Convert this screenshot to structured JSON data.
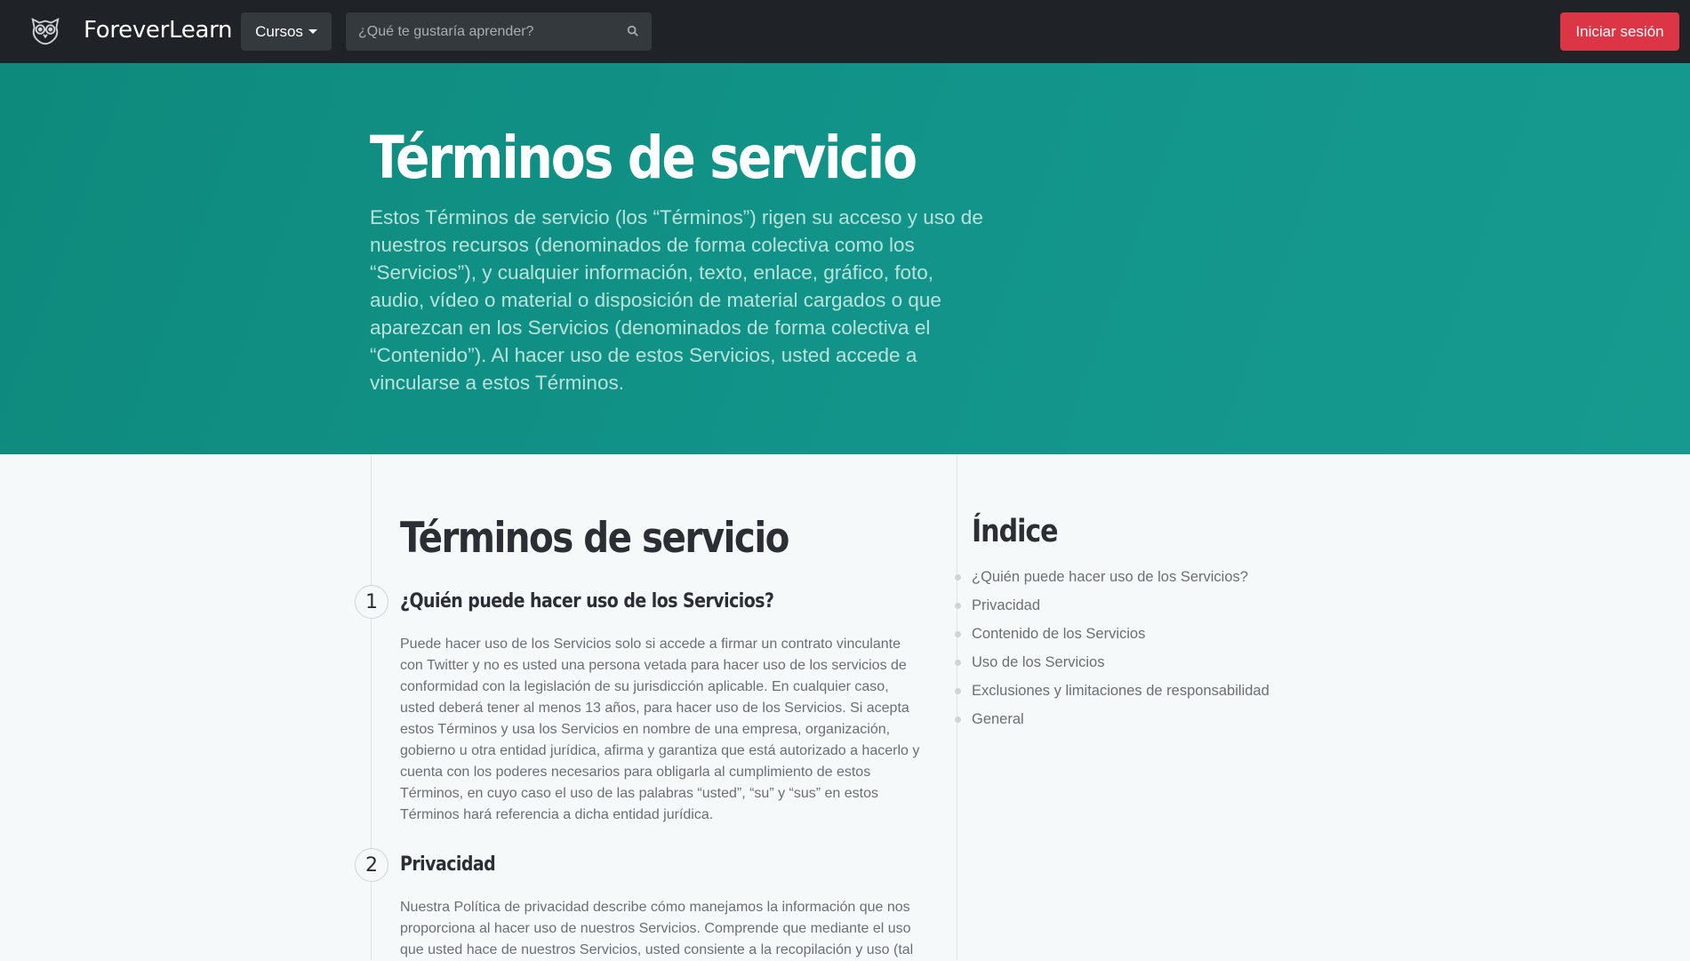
{
  "navbar": {
    "brand_name": "ForeverLearn",
    "logo_icon": "owl-logo-icon",
    "courses_label": "Cursos",
    "search_placeholder": "¿Qué te gustaría aprender?",
    "login_label": "Iniciar sesión"
  },
  "hero": {
    "title": "Términos de servicio",
    "text": "Estos Términos de servicio (los “Términos”) rigen su acceso y uso de nuestros recursos (denominados de forma colectiva como los “Servicios”), y cualquier información, texto, enlace, gráfico, foto, audio, vídeo o material o disposición de material cargados o que aparezcan en los Servicios (denominados de forma colectiva el “Contenido”). Al hacer uso de estos Servicios, usted accede a vincularse a estos Términos."
  },
  "main": {
    "title": "Términos de servicio",
    "sections": [
      {
        "number": "1",
        "title": "¿Quién puede hacer uso de los Servicios?",
        "body": "Puede hacer uso de los Servicios solo si accede a firmar un contrato vinculante con Twitter y no es usted una persona vetada para hacer uso de los servicios de conformidad con la legislación de su jurisdicción aplicable. En cualquier caso, usted deberá tener al menos 13 años, para hacer uso de los Servicios. Si acepta estos Términos y usa los Servicios en nombre de una empresa, organización, gobierno u otra entidad jurídica, afirma y garantiza que está autorizado a hacerlo y cuenta con los poderes necesarios para obligarla al cumplimiento de estos Términos, en cuyo caso el uso de las palabras “usted”, “su” y “sus” en estos Términos hará referencia a dicha entidad jurídica."
      },
      {
        "number": "2",
        "title": "Privacidad",
        "body": "Nuestra Política de privacidad describe cómo manejamos la información que nos proporciona al hacer uso de nuestros Servicios. Comprende que mediante el uso que usted hace de nuestros Servicios, usted consiente a la recopilación y uso (tal"
      }
    ]
  },
  "index": {
    "title": "Índice",
    "items": [
      "¿Quién puede hacer uso de los Servicios?",
      "Privacidad",
      "Contenido de los Servicios",
      "Uso de los Servicios",
      "Exclusiones y limitaciones de responsabilidad",
      "General"
    ]
  },
  "colors": {
    "navbar_bg": "#1f2327",
    "hero_bg": "#12948a",
    "login_button": "#dc3545",
    "page_bg": "#f6f9f9"
  }
}
